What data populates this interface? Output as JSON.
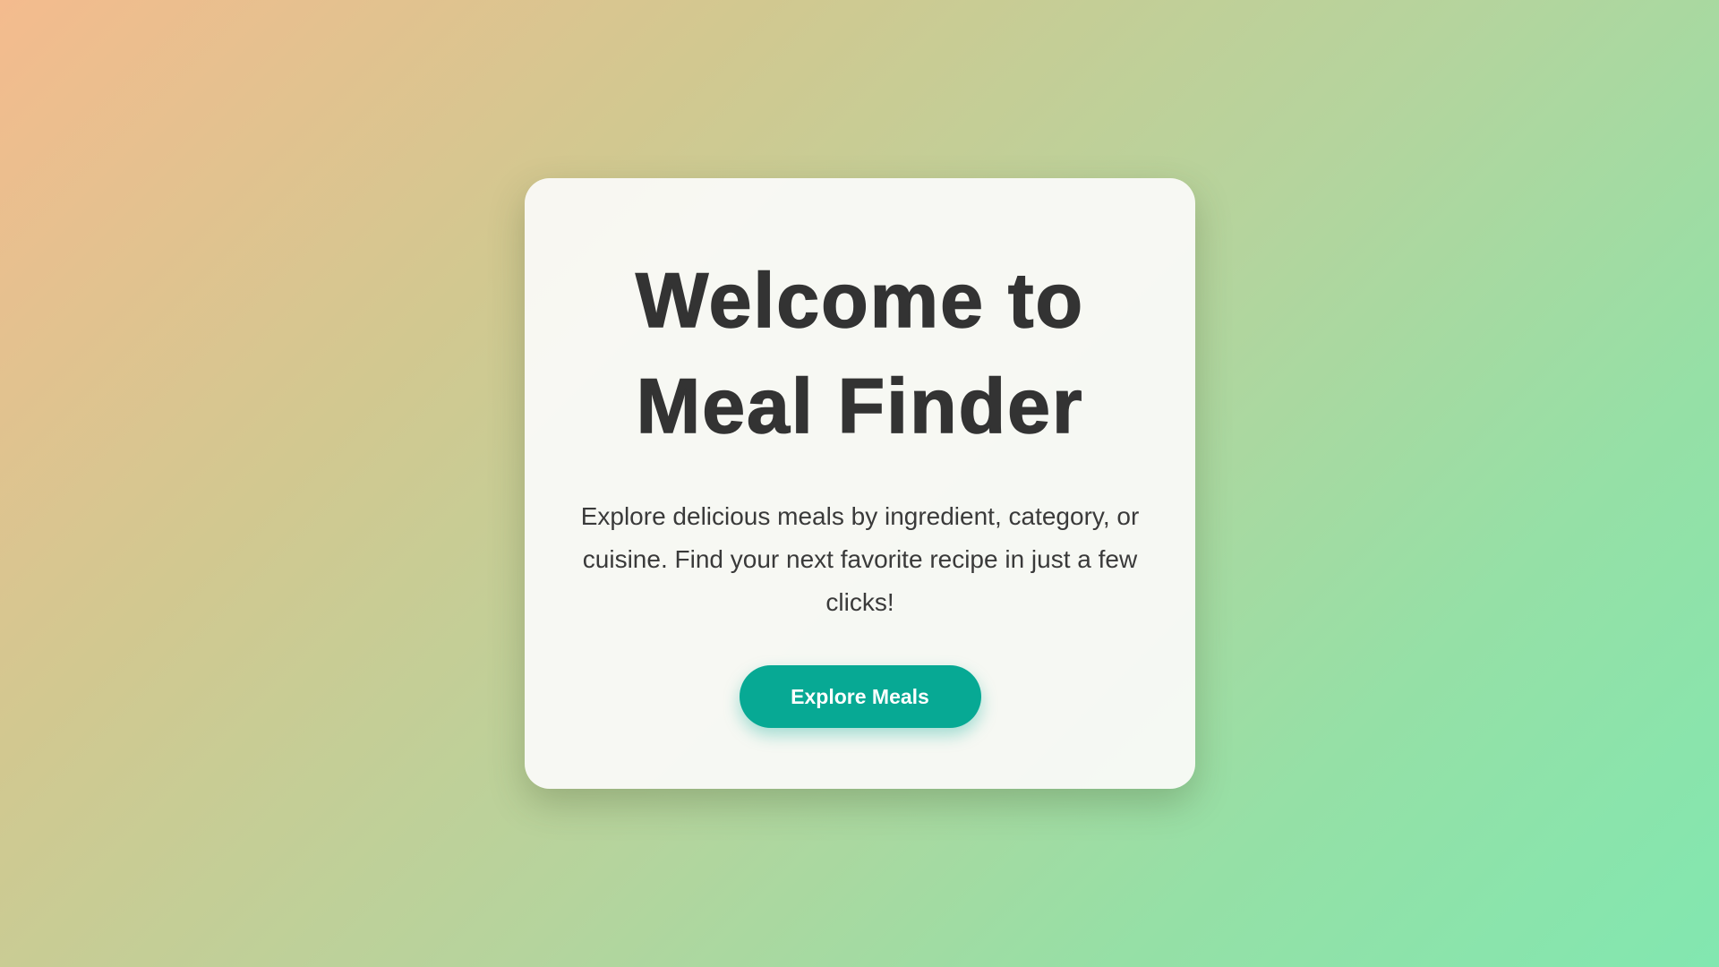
{
  "hero": {
    "title_line1": "Welcome to",
    "title_line2": "Meal Finder",
    "description": "Explore delicious meals by ingredient, category, or cuisine. Find your next favorite recipe in just a few clicks!",
    "cta_label": "Explore Meals"
  },
  "colors": {
    "accent": "#07a994",
    "text": "#333333",
    "card_background": "#fafaf8",
    "gradient_start": "#f4bb8e",
    "gradient_end": "#82e7b0"
  }
}
